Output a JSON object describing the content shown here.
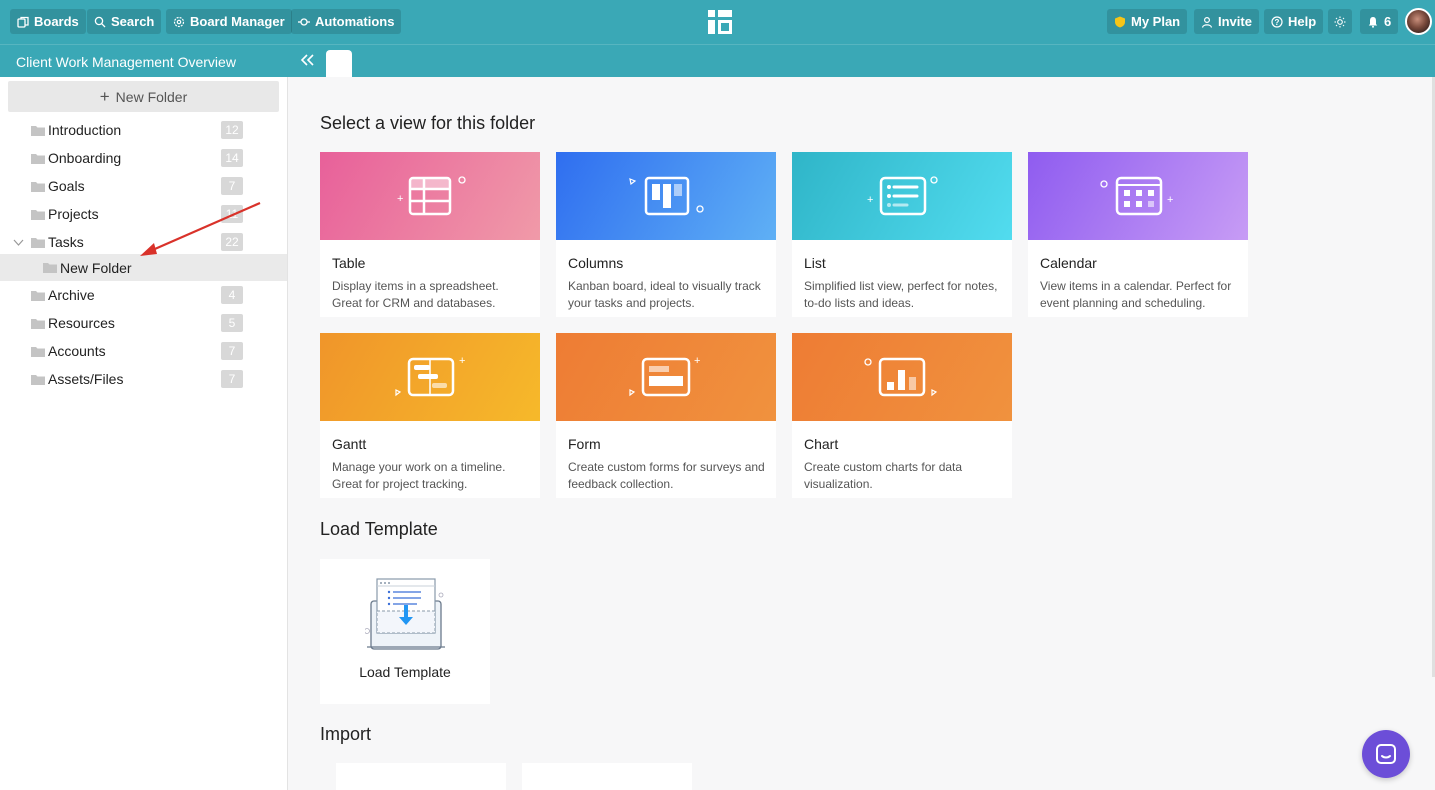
{
  "topbar": {
    "boards_label": "Boards",
    "search_label": "Search",
    "board_manager_label": "Board Manager",
    "automations_label": "Automations",
    "my_plan_label": "My Plan",
    "invite_label": "Invite",
    "help_label": "Help",
    "notifications_count": "6"
  },
  "subbar": {
    "board_title": "Client Work Management Overview"
  },
  "sidebar": {
    "new_folder_label": "New Folder",
    "folders": [
      {
        "label": "Introduction",
        "count": "12"
      },
      {
        "label": "Onboarding",
        "count": "14"
      },
      {
        "label": "Goals",
        "count": "7"
      },
      {
        "label": "Projects",
        "count": "11"
      },
      {
        "label": "Tasks",
        "count": "22"
      },
      {
        "label": "New Folder",
        "count": ""
      },
      {
        "label": "Archive",
        "count": "4"
      },
      {
        "label": "Resources",
        "count": "5"
      },
      {
        "label": "Accounts",
        "count": "7"
      },
      {
        "label": "Assets/Files",
        "count": "7"
      }
    ]
  },
  "main": {
    "select_view_title": "Select a view for this folder",
    "views": [
      {
        "title": "Table",
        "desc": "Display items in a spreadsheet. Great for CRM and databases."
      },
      {
        "title": "Columns",
        "desc": "Kanban board, ideal to visually track your tasks and projects."
      },
      {
        "title": "List",
        "desc": "Simplified list view, perfect for notes, to-do lists and ideas."
      },
      {
        "title": "Calendar",
        "desc": "View items in a calendar. Perfect for event planning and scheduling."
      },
      {
        "title": "Gantt",
        "desc": "Manage your work on a timeline. Great for project tracking."
      },
      {
        "title": "Form",
        "desc": "Create custom forms for surveys and feedback collection."
      },
      {
        "title": "Chart",
        "desc": "Create custom charts for data visualization."
      }
    ],
    "load_template_title": "Load Template",
    "load_template_label": "Load Template",
    "import_title": "Import"
  },
  "colors": {
    "topbar": "#3aa8b6",
    "table_gradient": [
      "#e8609a",
      "#f09aa8"
    ],
    "columns_gradient": [
      "#2f6ef0",
      "#5fb0f5"
    ],
    "list_gradient": [
      "#2fb5c8",
      "#52dcef"
    ],
    "calendar_gradient": [
      "#8f5cf0",
      "#c79cf5"
    ],
    "gantt_gradient": [
      "#f0952a",
      "#f6b92a"
    ],
    "form_gradient": [
      "#ee7c34",
      "#f0923e"
    ],
    "chart_gradient": [
      "#ee7c34",
      "#f0923e"
    ],
    "chat_button": "#6c4ed8",
    "annotation_arrow": "#d9322a"
  }
}
